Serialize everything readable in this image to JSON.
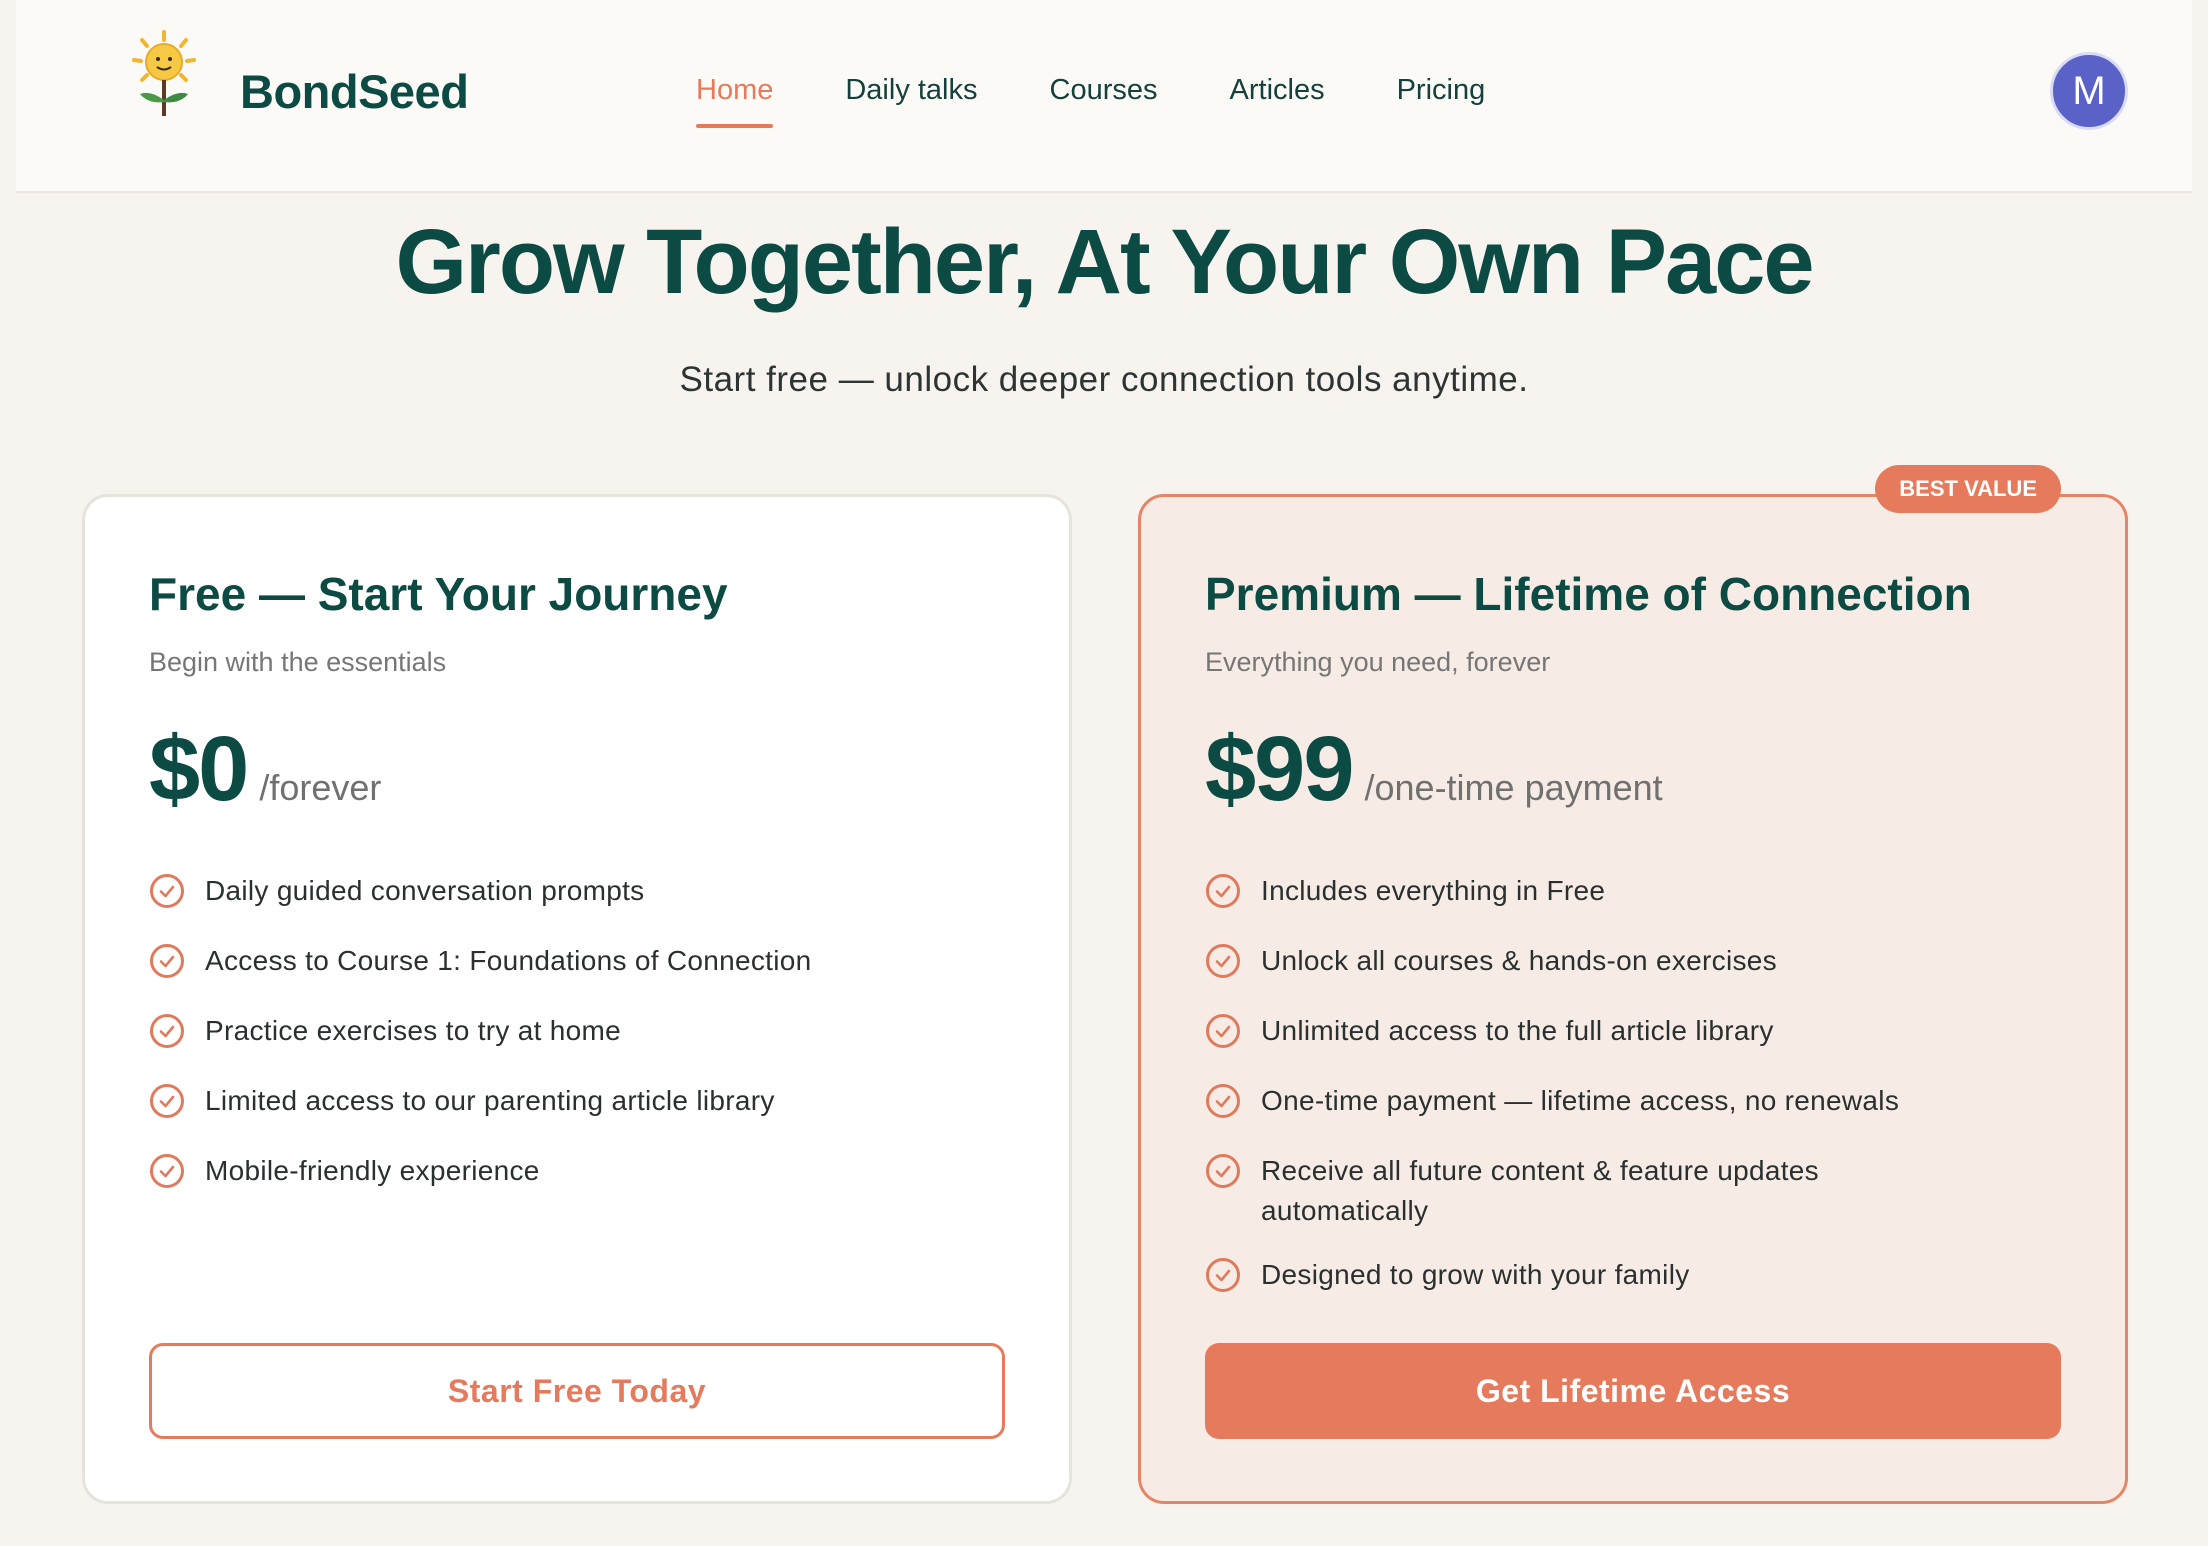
{
  "header": {
    "brand": "BondSeed",
    "logo_icon": "sunflower-icon",
    "nav": [
      {
        "label": "Home",
        "active": true
      },
      {
        "label": "Daily talks",
        "active": false
      },
      {
        "label": "Courses",
        "active": false
      },
      {
        "label": "Articles",
        "active": false
      },
      {
        "label": "Pricing",
        "active": false
      }
    ],
    "avatar_initial": "M"
  },
  "hero": {
    "title": "Grow Together, At Your Own Pace",
    "subtitle": "Start free — unlock deeper connection tools anytime."
  },
  "plans": {
    "free": {
      "title": "Free — Start Your Journey",
      "subtitle": "Begin with the essentials",
      "price": "$0",
      "period": "/forever",
      "features": [
        "Daily guided conversation prompts",
        "Access to Course 1: Foundations of Connection",
        "Practice exercises to try at home",
        "Limited access to our parenting article library",
        "Mobile-friendly experience"
      ],
      "cta": "Start Free Today"
    },
    "premium": {
      "badge": "BEST VALUE",
      "title": "Premium — Lifetime of Connection",
      "subtitle": "Everything you need, forever",
      "price": "$99",
      "period": "/one-time payment",
      "features": [
        "Includes everything in Free",
        "Unlock all courses & hands-on exercises",
        "Unlimited access to the full article library",
        "One-time payment — lifetime access, no renewals",
        "Receive all future content & feature updates automatically",
        "Designed to grow with your family"
      ],
      "cta": "Get Lifetime Access"
    }
  },
  "colors": {
    "accent": "#e57b5c",
    "brand": "#0c4a44",
    "background": "#f7f4ef",
    "premium_bg": "#f7ece5",
    "avatar": "#5a62c7"
  }
}
